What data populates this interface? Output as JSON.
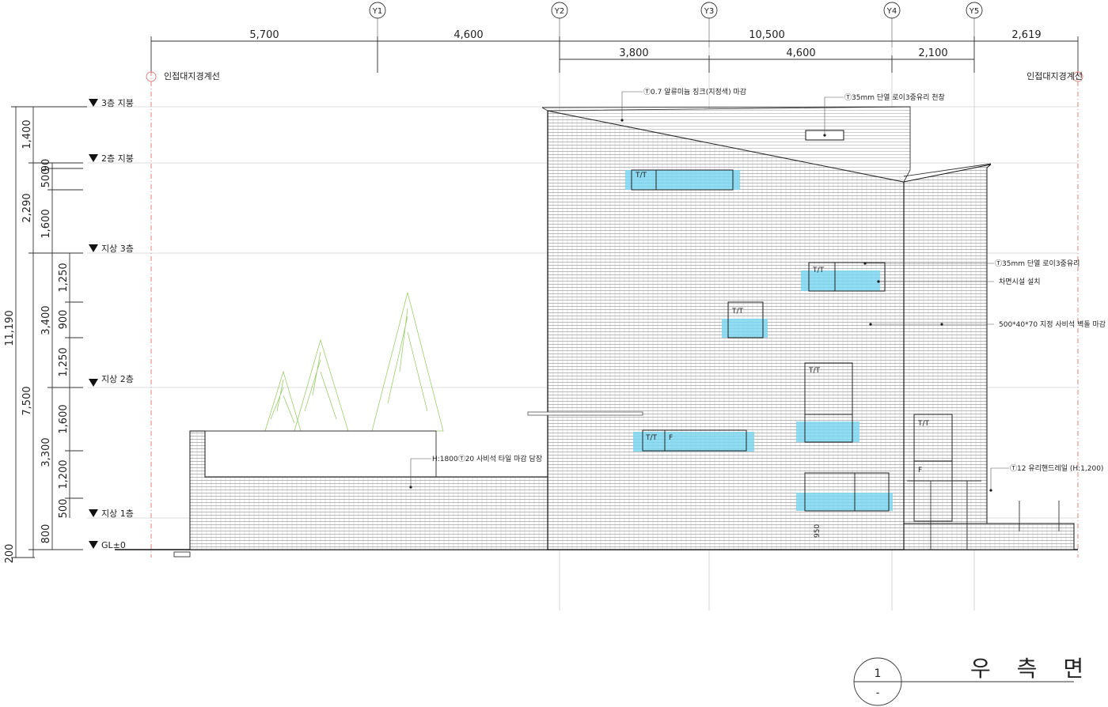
{
  "axes": [
    "Y1",
    "Y2",
    "Y3",
    "Y4",
    "Y5"
  ],
  "dims_top_row1": [
    "5,700",
    "4,600",
    "10,500",
    "2,619"
  ],
  "dims_top_row2": [
    "3,800",
    "4,600",
    "2,100"
  ],
  "boundary_left": "인접대지경계선",
  "boundary_right": "인접대지경계선",
  "levels": [
    "3층 지붕",
    "2층 지붕",
    "지상 3층",
    "지상 2층",
    "지상 1층",
    "GL±0"
  ],
  "dims_left_total": "11,190",
  "dims_left_col1": [
    "1,400",
    "2,290",
    "7,500",
    "200"
  ],
  "dims_left_col2": [
    "500",
    "90",
    "1,600",
    "3,400",
    "3,300",
    "800"
  ],
  "dims_left_col3": [
    "1,250",
    "900",
    "1,250",
    "1,600",
    "1,200",
    "500"
  ],
  "notes": {
    "roof_finish": "Ⓣ0.7 알류미늄 징크(지정색) 마감",
    "skylight": "Ⓣ35mm 단열 로이3중유리 천창",
    "glass": "Ⓣ35mm 단열 로이3중유리",
    "shading": "차면시설 설치",
    "wall_brick": "500*40*70 지정 사비석 벽돌 마감",
    "fence": "H:1800Ⓣ20 사비석 타일 마감 담장",
    "handrail": "Ⓣ12 유리핸드레일 (H:1,200)",
    "height_950": "950"
  },
  "window_labels": {
    "tt": "T/T",
    "f": "F"
  },
  "title": {
    "number": "1",
    "scale": "-",
    "name": "우 측 면 도"
  }
}
